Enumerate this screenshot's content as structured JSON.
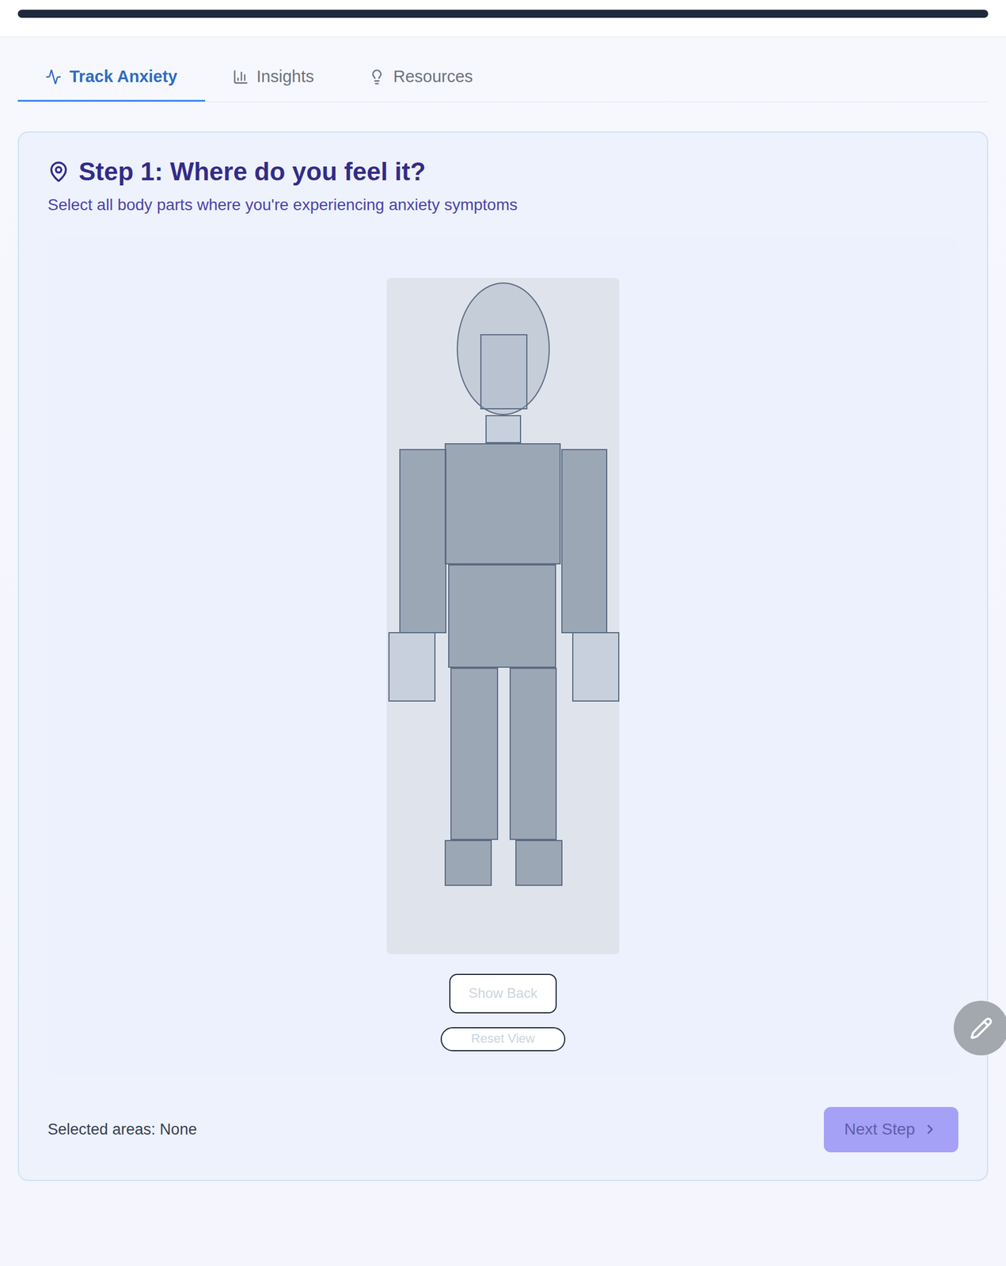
{
  "tabs": [
    {
      "label": "Track Anxiety",
      "selected": true
    },
    {
      "label": "Insights",
      "selected": false
    },
    {
      "label": "Resources",
      "selected": false
    }
  ],
  "step": {
    "title": "Step 1: Where do you feel it?",
    "subtitle": "Select all body parts where you're experiencing anxiety symptoms"
  },
  "body_regions": [
    {
      "selected": false
    },
    {
      "selected": false
    },
    {
      "selected": false
    },
    {
      "selected": false
    },
    {
      "selected": false
    },
    {
      "selected": false
    },
    {
      "selected": false
    },
    {
      "selected": false
    },
    {
      "selected": false
    },
    {
      "selected": false
    },
    {
      "selected": false
    },
    {
      "selected": false
    },
    {
      "selected": false
    }
  ],
  "body_buttons": [
    "Show Back",
    "Reset View"
  ],
  "footer": {
    "selected_label": "Selected areas: None",
    "next_button": {
      "label": "Next Step",
      "disabled": true
    }
  }
}
